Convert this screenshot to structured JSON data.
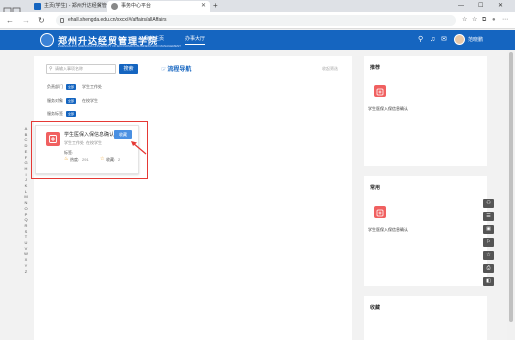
{
  "browser": {
    "tabs": [
      {
        "title": "主页(学生) - 郑州升达经贸管",
        "active": false
      },
      {
        "title": "事务中心平台",
        "active": true
      }
    ],
    "new_tab": "+",
    "window_controls": [
      "—",
      "☐",
      "✕"
    ],
    "url": "ehall.shengda.edu.cn/xxcx/#/affairs/allAffairs",
    "nav": {
      "back": "←",
      "forward": "→",
      "reload": "↻"
    },
    "toolbar_icons": [
      "☆",
      "☆",
      "⧉",
      "●",
      "⋯"
    ]
  },
  "header": {
    "logo_text": "郑州升达经贸管理学院",
    "logo_sub": "ZHENGZHOU SHENGDA UNIVERSITY OF ECONOMICS BUSINESS AND MANAGEMENT",
    "nav": [
      "我的主页",
      "办事大厅"
    ],
    "active_nav": "办事大厅",
    "icons": [
      "⚲",
      "♫",
      "✉",
      "⊕"
    ],
    "username": "范晓鹏"
  },
  "search": {
    "placeholder": "请输入事项名称",
    "button": "搜索"
  },
  "guide": "流程导航",
  "collapse": "收起筛选",
  "filters": [
    {
      "label": "负责部门",
      "chip": "全部",
      "value": "学生工作处"
    },
    {
      "label": "服务对象",
      "chip": "全部",
      "value": "在校学生"
    },
    {
      "label": "服务标签",
      "chip": "全部",
      "value": ""
    }
  ],
  "letters": [
    "A",
    "B",
    "C",
    "D",
    "E",
    "F",
    "G",
    "H",
    "I",
    "J",
    "K",
    "L",
    "M",
    "N",
    "O",
    "P",
    "Q",
    "R",
    "S",
    "T",
    "U",
    "V",
    "W",
    "X",
    "Y",
    "Z"
  ],
  "card": {
    "title": "学生医保入保信息确认",
    "dept": "学生工作处",
    "audience": "在校学生",
    "label": "标签:",
    "heat_label": "热度:",
    "heat": "291",
    "fav_label": "收藏:",
    "favorites": "2",
    "fav_button": "收藏"
  },
  "right": {
    "recommend_title": "推荐",
    "recommend_item": "学生医保入保信息确认",
    "common_title": "常用",
    "common_item": "学生医保入保信息确认",
    "favorites_title": "收藏"
  },
  "right_toolbar": [
    "⚇",
    "☰",
    "▣",
    "⚐",
    "☆",
    "⎙",
    "◧"
  ],
  "colors": {
    "brand": "#1565c0",
    "highlight": "#e53935",
    "icon": "#f06060"
  }
}
